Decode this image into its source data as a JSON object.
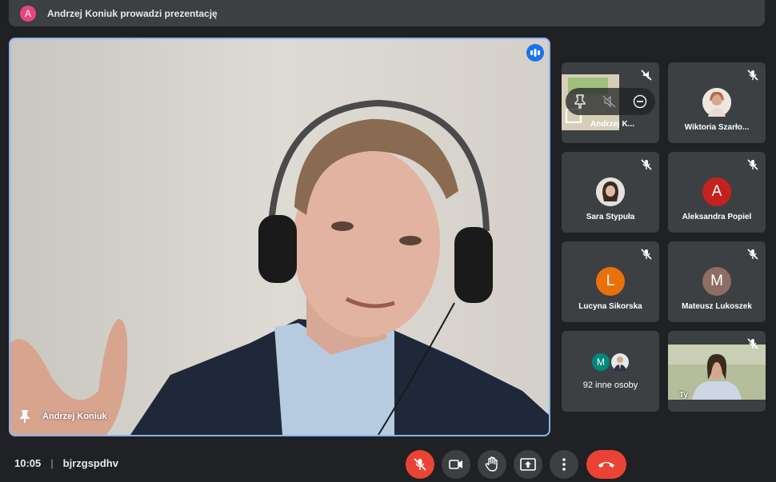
{
  "banner": {
    "avatar_letter": "A",
    "avatar_color": "#e8457c",
    "text": "Andrzej Koniuk prowadzi prezentację"
  },
  "main_video": {
    "participant_name": "Andrzej Koniuk"
  },
  "tiles": [
    {
      "name": "Andrzej K...",
      "avatar": "",
      "avatar_color": ""
    },
    {
      "name": "Wiktoria Szarło...",
      "avatar": "",
      "avatar_color": "#e0c7b8"
    },
    {
      "name": "Sara Stypuła",
      "avatar": "",
      "avatar_color": "#d9d3cf"
    },
    {
      "name": "Aleksandra Popiel",
      "avatar": "A",
      "avatar_color": "#c5221f"
    },
    {
      "name": "Lucyna Sikorska",
      "avatar": "L",
      "avatar_color": "#e8710a"
    },
    {
      "name": "Mateusz Lukoszek",
      "avatar": "M",
      "avatar_color": "#8d6e63"
    },
    {
      "name": "92 inne osoby",
      "avatar_letter": "M",
      "avatar_color": "#00897b"
    },
    {
      "name": "Ty"
    }
  ],
  "footer": {
    "time": "10:05",
    "meeting_code": "bjrzgspdhv"
  }
}
